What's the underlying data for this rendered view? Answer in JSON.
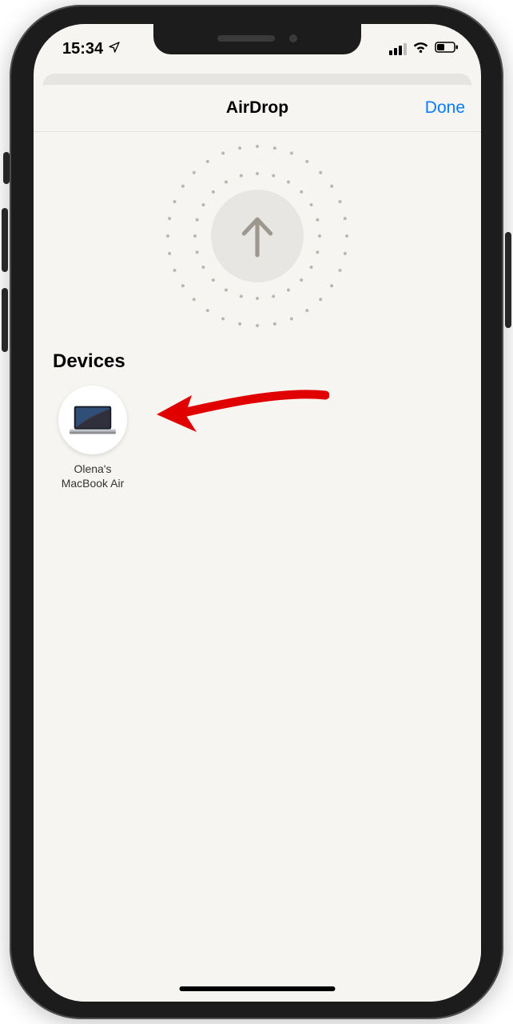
{
  "status_bar": {
    "time": "15:34",
    "location_services": true,
    "battery_percent": 40
  },
  "sheet": {
    "title": "AirDrop",
    "done_label": "Done"
  },
  "devices": {
    "section_label": "Devices",
    "list": [
      {
        "name": "Olena's MacBook Air",
        "icon": "macbook-air"
      }
    ]
  },
  "colors": {
    "ios_blue": "#0a7aff",
    "annotation_red": "#e10000"
  }
}
